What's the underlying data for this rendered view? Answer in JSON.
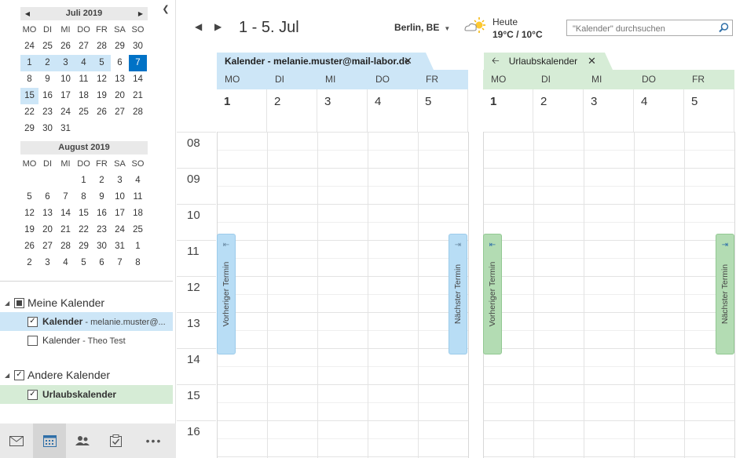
{
  "nav": {
    "months": [
      {
        "title": "Juli 2019",
        "weekdays": [
          "MO",
          "DI",
          "MI",
          "DO",
          "FR",
          "SA",
          "SO"
        ],
        "weeks": [
          [
            "24",
            "25",
            "26",
            "27",
            "28",
            "29",
            "30"
          ],
          [
            "1",
            "2",
            "3",
            "4",
            "5",
            "6",
            "7"
          ],
          [
            "8",
            "9",
            "10",
            "11",
            "12",
            "13",
            "14"
          ],
          [
            "15",
            "16",
            "17",
            "18",
            "19",
            "20",
            "21"
          ],
          [
            "22",
            "23",
            "24",
            "25",
            "26",
            "27",
            "28"
          ],
          [
            "29",
            "30",
            "31",
            "",
            "",
            "",
            ""
          ]
        ]
      },
      {
        "title": "August 2019",
        "weekdays": [
          "MO",
          "DI",
          "MI",
          "DO",
          "FR",
          "SA",
          "SO"
        ],
        "weeks": [
          [
            "",
            "",
            "",
            "1",
            "2",
            "3",
            "4"
          ],
          [
            "5",
            "6",
            "7",
            "8",
            "9",
            "10",
            "11"
          ],
          [
            "12",
            "13",
            "14",
            "15",
            "16",
            "17",
            "18"
          ],
          [
            "19",
            "20",
            "21",
            "22",
            "23",
            "24",
            "25"
          ],
          [
            "26",
            "27",
            "28",
            "29",
            "30",
            "31",
            "1"
          ],
          [
            "2",
            "3",
            "4",
            "5",
            "6",
            "7",
            "8"
          ]
        ]
      }
    ],
    "groups": [
      {
        "label": "Meine Kalender"
      },
      {
        "label": "Andere Kalender"
      }
    ],
    "calendars": [
      {
        "name": "Kalender",
        "sub": " - melanie.muster@...",
        "checked": "✓"
      },
      {
        "name": "Kalender",
        "sub": " - Theo Test",
        "checked": ""
      },
      {
        "name": "Urlaubskalender",
        "sub": "",
        "checked": "✓"
      }
    ],
    "bottom_more": "•••"
  },
  "main": {
    "range_title": "1 - 5. Jul",
    "weather": {
      "location": "Berlin, BE",
      "label": "Heute",
      "temp": "19°C / 10°C"
    },
    "search_placeholder": "\"Kalender\" durchsuchen",
    "tabs": [
      {
        "label": "Kalender - melanie.muster@mail-labor.de"
      },
      {
        "label": "Urlaubskalender"
      }
    ],
    "weekdays": [
      "MO",
      "DI",
      "MI",
      "DO",
      "FR"
    ],
    "days": [
      "1",
      "2",
      "3",
      "4",
      "5"
    ],
    "hours": [
      "08",
      "09",
      "10",
      "11",
      "12",
      "13",
      "14",
      "15",
      "16"
    ],
    "prev_label": "Vorheriger Termin",
    "next_label": "Nächster Termin"
  },
  "colors": {
    "accent": "#0072c6",
    "blue_calendar": "#cde6f7",
    "green_calendar": "#d6ecd6"
  }
}
